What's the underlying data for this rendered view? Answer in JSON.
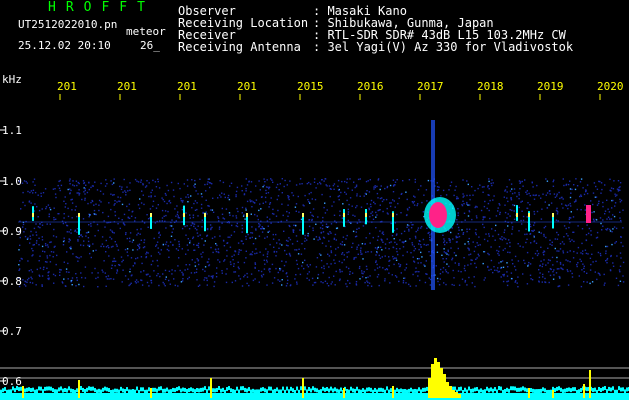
{
  "header": {
    "app_name": "HROFFT",
    "filename": "UT2512022010.pn",
    "mode": "meteor",
    "datetime": "25.12.02 20:10",
    "number": "26_"
  },
  "info": [
    {
      "label": "Observer",
      "value": ": Masaki Kano"
    },
    {
      "label": "Receiving Location",
      "value": ": Shibukawa, Gunma, Japan"
    },
    {
      "label": "Receiver",
      "value": ": RTL-SDR SDR# 43dB L15 103.2MHz CW"
    },
    {
      "label": "Receiving Antenna",
      "value": ": 3el Yagi(V) Az 330 for Vladivostok"
    }
  ],
  "axis": {
    "unit": "kHz",
    "x_ticks": [
      "201",
      "201",
      "201",
      "201",
      "2015",
      "2016",
      "2017",
      "2018",
      "2019",
      "2020"
    ],
    "y_ticks": [
      "1.1",
      "1.0",
      "0.9",
      "0.8",
      "0.7",
      "0.6"
    ]
  },
  "colors": {
    "background": "#000000",
    "noise": "#1a2aa8",
    "signal": "#00ffff",
    "strong": "#ff2288",
    "histogram": "#ffff00",
    "tick_text": "#ffff00",
    "label_text": "#ffffff",
    "title_text": "#00ff00"
  }
}
